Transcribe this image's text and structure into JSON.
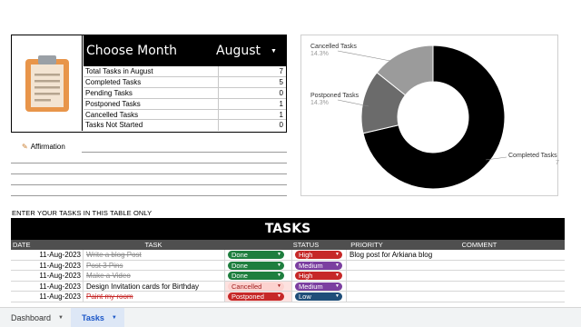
{
  "summary": {
    "title": "Choose Month",
    "month": "August",
    "stats": [
      {
        "label": "Total Tasks in August",
        "value": "7"
      },
      {
        "label": "Completed Tasks",
        "value": "5"
      },
      {
        "label": "Pending Tasks",
        "value": "0"
      },
      {
        "label": "Postponed Tasks",
        "value": "1"
      },
      {
        "label": "Cancelled Tasks",
        "value": "1"
      },
      {
        "label": "Tasks Not Started",
        "value": "0"
      }
    ]
  },
  "affirmation": {
    "label": "Affirmation"
  },
  "chart_data": {
    "type": "pie",
    "donut": true,
    "slices": [
      {
        "label": "Completed Tasks",
        "pct": "71.4%",
        "value": 71.4,
        "color": "#000000"
      },
      {
        "label": "Postponed Tasks",
        "pct": "14.3%",
        "value": 14.3,
        "color": "#6b6b6b"
      },
      {
        "label": "Cancelled Tasks",
        "pct": "14.3%",
        "value": 14.3,
        "color": "#9b9b9b"
      }
    ],
    "legend": "labels-outside"
  },
  "instruction": "ENTER YOUR TASKS IN THIS TABLE ONLY",
  "table": {
    "title": "TASKS",
    "headers": {
      "date": "DATE",
      "task": "TASK",
      "status": "STATUS",
      "priority": "PRIORITY",
      "comment": "COMMENT"
    },
    "rows": [
      {
        "date": "11-Aug-2023",
        "task": "Write a blog Post",
        "struck": true,
        "status": "Done",
        "priority": "High",
        "comment": "Blog post for Arkiana blog"
      },
      {
        "date": "11-Aug-2023",
        "task": "Post 3 Pins",
        "struck": true,
        "status": "Done",
        "priority": "Medium",
        "comment": ""
      },
      {
        "date": "11-Aug-2023",
        "task": "Make a Video",
        "struck": true,
        "status": "Done",
        "priority": "High",
        "comment": ""
      },
      {
        "date": "11-Aug-2023",
        "task": "Design Invitation cards for Birthday",
        "struck": false,
        "status": "Cancelled",
        "priority": "Medium",
        "comment": ""
      },
      {
        "date": "11-Aug-2023",
        "task": "Paint my room",
        "struck": false,
        "status": "Postponed",
        "priority": "Low",
        "comment": ""
      }
    ]
  },
  "colors": {
    "Done": "#1e7e3e",
    "Cancelled": "#fcd2cf",
    "Postponed": "#c62828",
    "High": "#c62828",
    "Medium": "#7b3fa0",
    "Low": "#1f4e79",
    "row_cancelled": "#fde2e0",
    "row_postponed": "#fde2e0"
  },
  "sheet_tabs": [
    {
      "label": "Dashboard",
      "active": false
    },
    {
      "label": "Tasks",
      "active": true
    }
  ]
}
